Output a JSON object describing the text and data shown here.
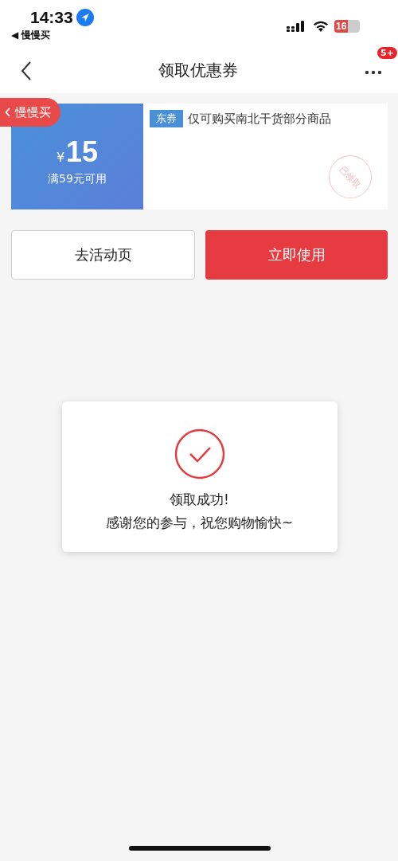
{
  "status_bar": {
    "time": "14:33",
    "back_app": "◀ 慢慢买",
    "battery": "16"
  },
  "nav": {
    "title": "领取优惠券",
    "badge": "5+"
  },
  "return_pill": {
    "label": "慢慢买"
  },
  "coupon": {
    "currency": "¥",
    "amount": "15",
    "condition": "满59元可用",
    "tag": "东券",
    "description": "仅可购买南北干货部分商品",
    "stamp": "已领取"
  },
  "buttons": [
    {
      "label": "去活动页",
      "kind": "secondary"
    },
    {
      "label": "立即使用",
      "kind": "primary"
    }
  ],
  "toast": {
    "title": "领取成功!",
    "message": "感谢您的参与，祝您购物愉快~"
  }
}
